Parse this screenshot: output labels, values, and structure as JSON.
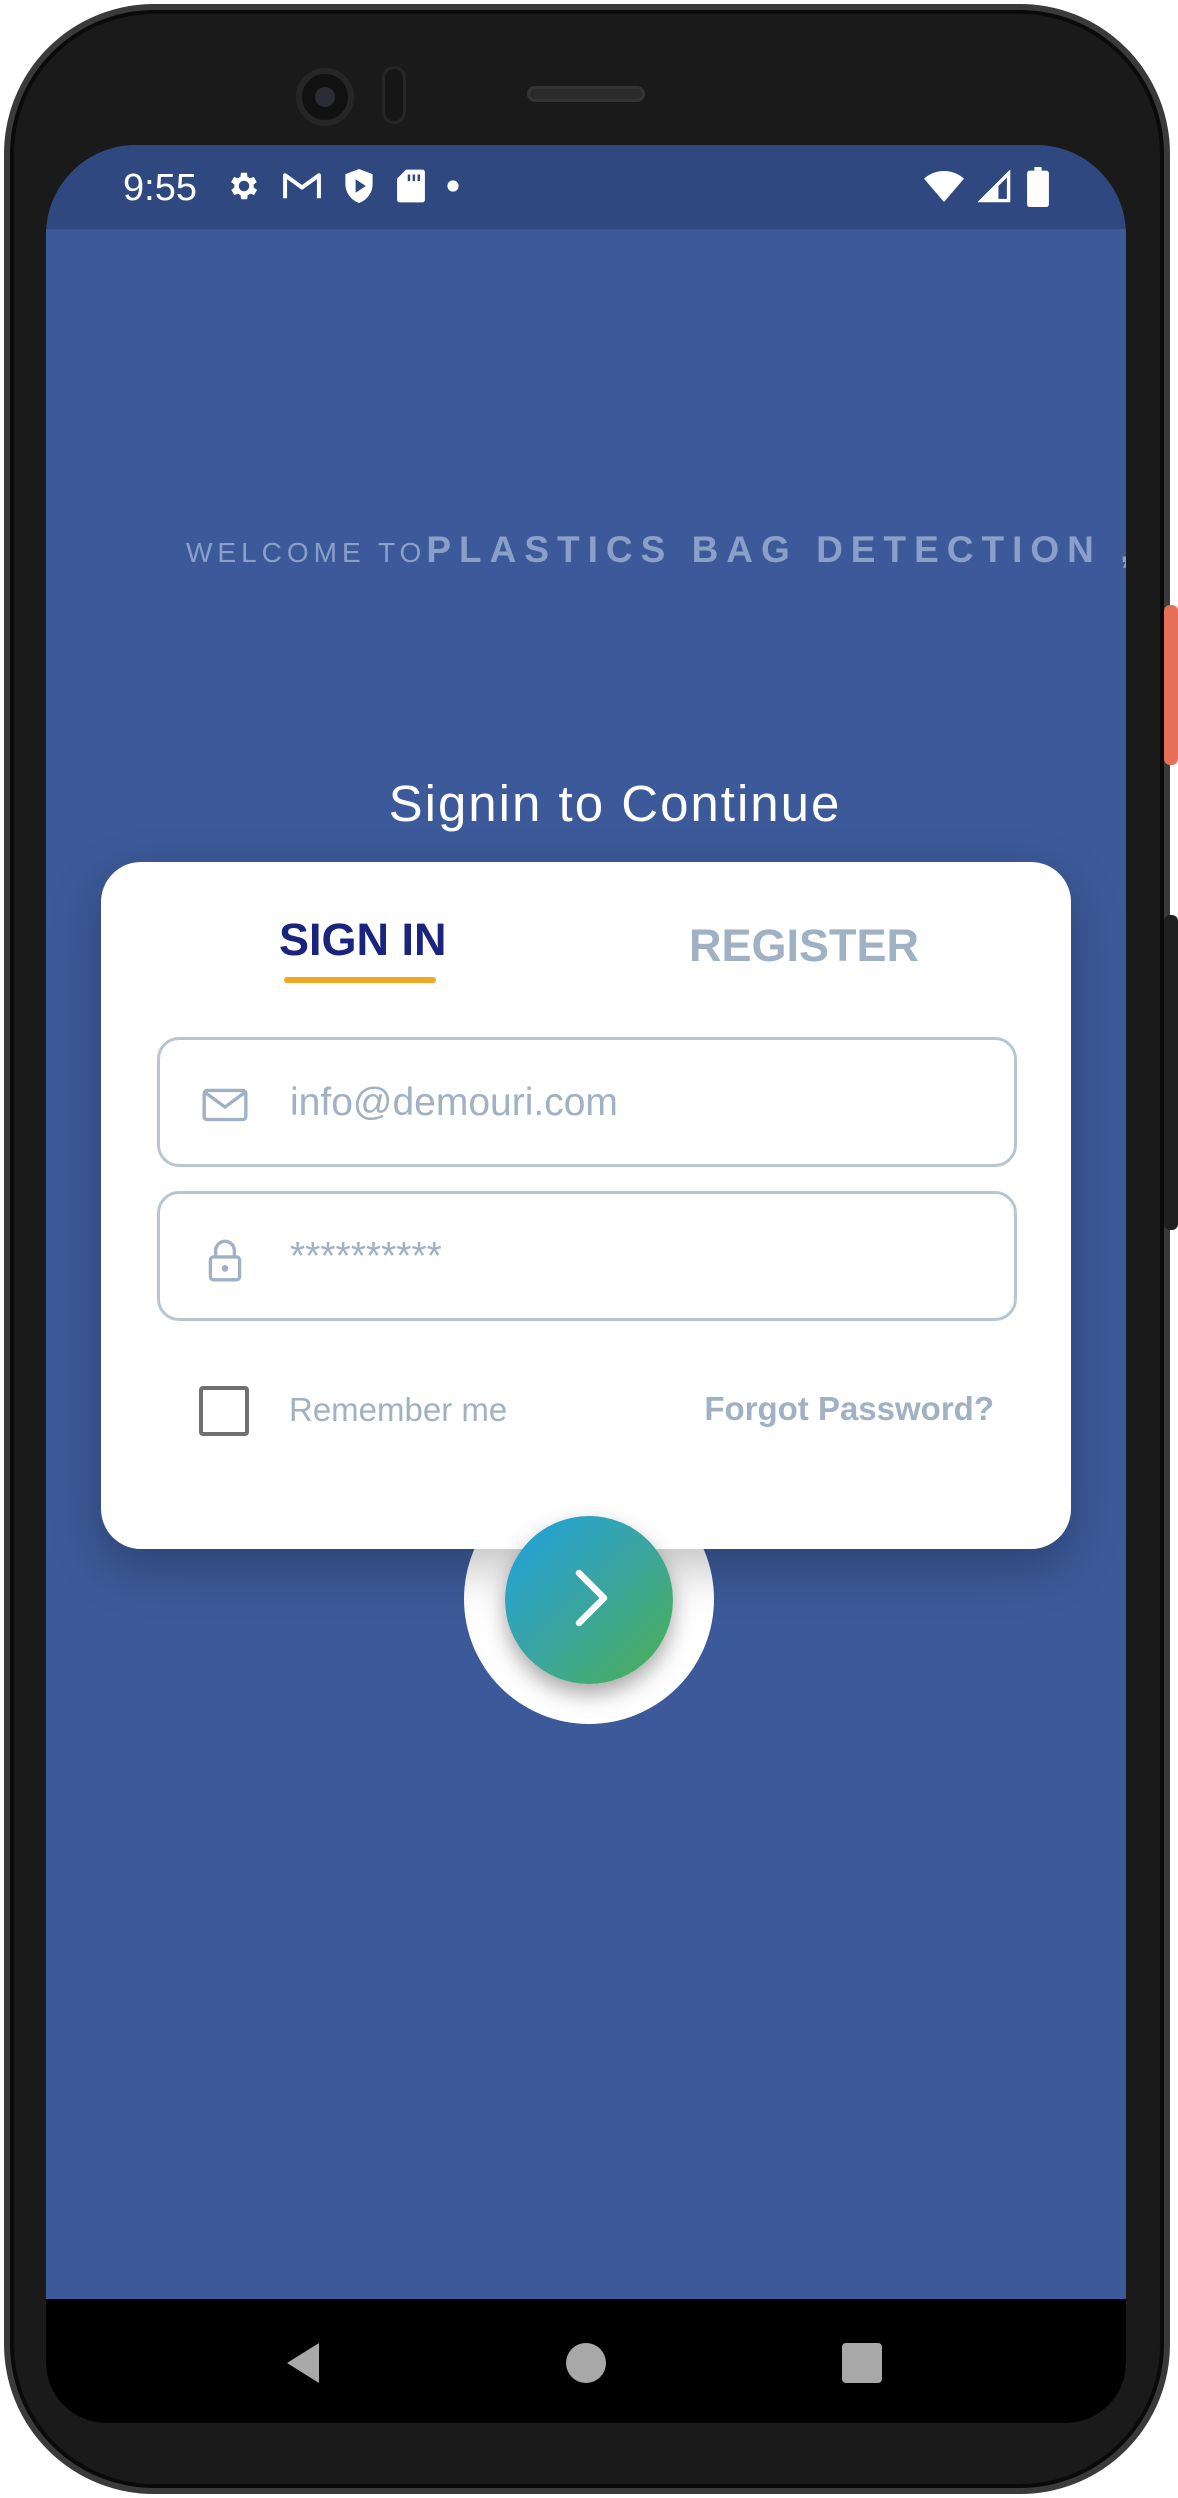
{
  "status_bar": {
    "time": "9:55",
    "left_icons": [
      "gear-icon",
      "gmail-icon",
      "shield-play-icon",
      "sd-card-icon",
      "dot-icon"
    ],
    "right_icons": [
      "wifi-icon",
      "cell-signal-icon",
      "battery-icon"
    ]
  },
  "header": {
    "welcome_prefix": "WELCOME TO",
    "app_name": "PLASTICS BAG DETECTION ,",
    "subtitle": "Signin to Continue"
  },
  "card": {
    "tabs": [
      {
        "label": "SIGN IN",
        "active": true
      },
      {
        "label": "REGISTER",
        "active": false
      }
    ],
    "email": {
      "value": "",
      "placeholder": "info@demouri.com",
      "icon": "mail-icon"
    },
    "password": {
      "value": "",
      "placeholder": "**********",
      "icon": "lock-icon"
    },
    "remember_label": "Remember me",
    "remember_checked": false,
    "forgot_label": "Forgot Password?"
  },
  "submit_icon": "chevron-right-icon",
  "nav_bar": {
    "buttons": [
      "back-icon",
      "home-icon",
      "recents-icon"
    ]
  },
  "colors": {
    "background": "#3c5a99",
    "status_bar": "#2f4880",
    "active_tab": "#1a237e",
    "tab_indicator": "#f5a623",
    "muted_text": "#9fb1c2",
    "submit_gradient_start": "#1ea1e0",
    "submit_gradient_end": "#4caf50"
  }
}
